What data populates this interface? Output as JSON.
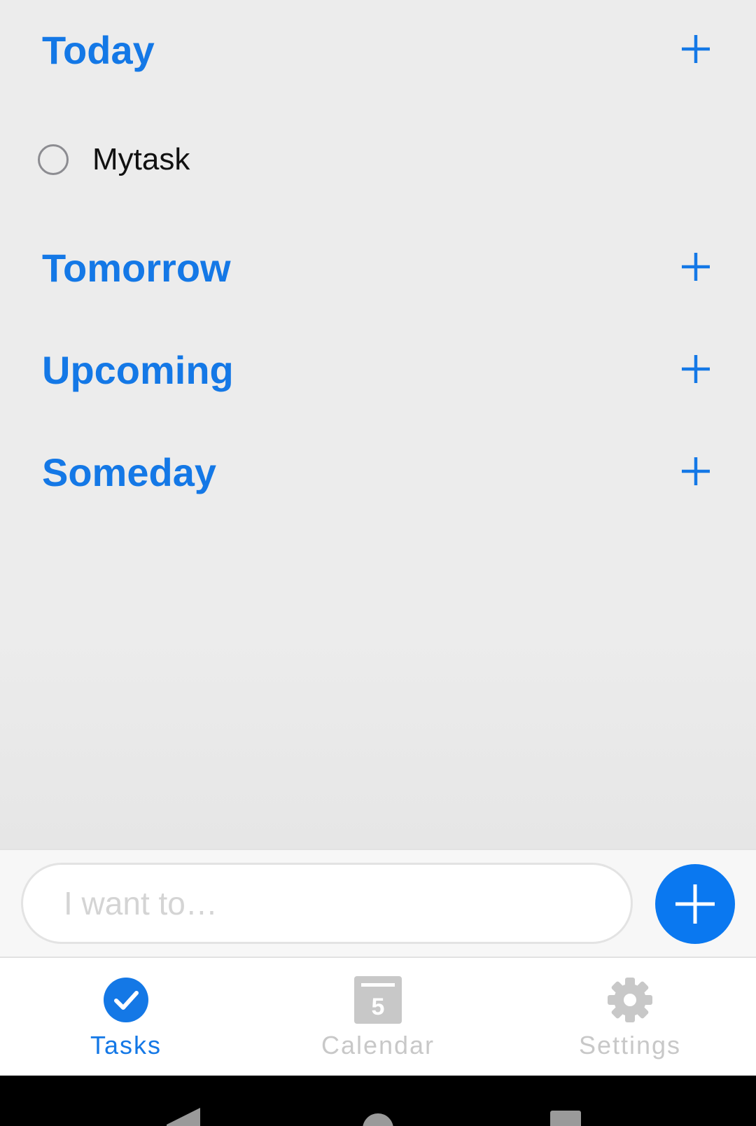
{
  "colors": {
    "accent": "#1478e6",
    "fab": "#0a78f0",
    "inactive_tab": "#c8c8c8",
    "background": "#ececec"
  },
  "sections": [
    {
      "title": "Today",
      "add_icon": "plus-icon"
    },
    {
      "title": "Tomorrow",
      "add_icon": "plus-icon"
    },
    {
      "title": "Upcoming",
      "add_icon": "plus-icon"
    },
    {
      "title": "Someday",
      "add_icon": "plus-icon"
    }
  ],
  "tasks": [
    {
      "label": "Mytask",
      "section": "Today",
      "completed": false
    }
  ],
  "composer": {
    "placeholder": "I want to…",
    "value": "",
    "add_icon": "plus-icon"
  },
  "tabbar": {
    "tabs": [
      {
        "label": "Tasks",
        "icon": "checkmark-circle-icon",
        "active": true
      },
      {
        "label": "Calendar",
        "icon": "calendar-icon",
        "icon_text": "5",
        "active": false
      },
      {
        "label": "Settings",
        "icon": "gear-icon",
        "active": false
      }
    ]
  },
  "system_nav": {
    "buttons": [
      "back-icon",
      "home-icon",
      "recents-icon"
    ]
  }
}
